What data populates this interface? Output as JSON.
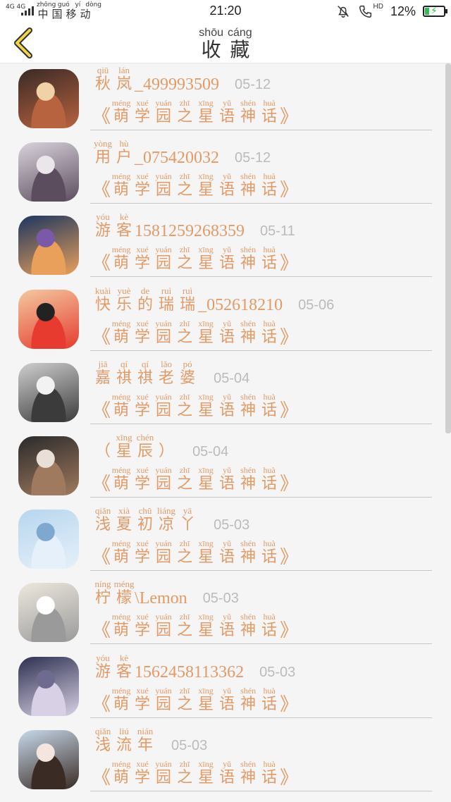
{
  "status_bar": {
    "network": "4G 4G",
    "carrier": [
      {
        "py": "zhōng",
        "hz": "中"
      },
      {
        "py": "guó",
        "hz": "国"
      },
      {
        "py": "yí",
        "hz": "移"
      },
      {
        "py": "dòng",
        "hz": "动"
      }
    ],
    "time": "21:20",
    "hd_label": "HD",
    "battery": "12%"
  },
  "header": {
    "back_icon": "chevron-left-icon",
    "title": [
      {
        "py": "shōu",
        "hz": "收"
      },
      {
        "py": "cáng",
        "hz": "藏"
      }
    ]
  },
  "subtitle": {
    "open": "《",
    "close": "》",
    "chars": [
      {
        "py": "méng",
        "hz": "萌"
      },
      {
        "py": "xué",
        "hz": "学"
      },
      {
        "py": "yuán",
        "hz": "园"
      },
      {
        "py": "zhī",
        "hz": "之"
      },
      {
        "py": "xīng",
        "hz": "星"
      },
      {
        "py": "yǔ",
        "hz": "语"
      },
      {
        "py": "shén",
        "hz": "神"
      },
      {
        "py": "huà",
        "hz": "话"
      }
    ]
  },
  "items": [
    {
      "name": [
        {
          "py": "qiū",
          "hz": "秋"
        },
        {
          "py": "lán",
          "hz": "岚"
        }
      ],
      "suffix": "_499993509",
      "date": "05-12",
      "avatar": {
        "c1": "#3a2a26",
        "c2": "#b8633f",
        "c3": "#f1d1a8"
      }
    },
    {
      "name": [
        {
          "py": "yòng",
          "hz": "用"
        },
        {
          "py": "hù",
          "hz": "户"
        }
      ],
      "suffix": "_075420032",
      "date": "05-12",
      "avatar": {
        "c1": "#d9d3dc",
        "c2": "#5c4d5e",
        "c3": "#eae6ea"
      }
    },
    {
      "name": [
        {
          "py": "yóu",
          "hz": "游"
        },
        {
          "py": "kè",
          "hz": "客"
        }
      ],
      "suffix": "1581259268359",
      "date": "05-11",
      "avatar": {
        "c1": "#1c3560",
        "c2": "#e9a05a",
        "c3": "#7a5aa8"
      }
    },
    {
      "name": [
        {
          "py": "kuài",
          "hz": "快"
        },
        {
          "py": "yuè",
          "hz": "乐"
        },
        {
          "py": "de",
          "hz": "的"
        },
        {
          "py": "ruì",
          "hz": "瑞"
        },
        {
          "py": "ruì",
          "hz": "瑞"
        }
      ],
      "suffix": "_052618210",
      "date": "05-06",
      "avatar": {
        "c1": "#f3c9a0",
        "c2": "#e63b2e",
        "c3": "#222222"
      }
    },
    {
      "name": [
        {
          "py": "jiā",
          "hz": "嘉"
        },
        {
          "py": "qí",
          "hz": "祺"
        },
        {
          "py": "qí",
          "hz": "祺"
        },
        {
          "py": "lǎo",
          "hz": "老"
        },
        {
          "py": "pó",
          "hz": "婆"
        }
      ],
      "suffix": "",
      "date": "05-04",
      "avatar": {
        "c1": "#cfcfcf",
        "c2": "#3b3b3b",
        "c3": "#f2f2f2"
      }
    },
    {
      "name": [
        {
          "py": "",
          "hz": "（"
        },
        {
          "py": "xīng",
          "hz": "星"
        },
        {
          "py": "chén",
          "hz": "辰"
        },
        {
          "py": "",
          "hz": "）"
        }
      ],
      "suffix": "",
      "date": "05-04",
      "avatar": {
        "c1": "#2a2a2a",
        "c2": "#a07a5e",
        "c3": "#e8e0d8"
      }
    },
    {
      "name": [
        {
          "py": "qiǎn",
          "hz": "浅"
        },
        {
          "py": "xià",
          "hz": "夏"
        },
        {
          "py": "chū",
          "hz": "初"
        },
        {
          "py": "liáng",
          "hz": "凉"
        },
        {
          "py": "yā",
          "hz": "丫"
        }
      ],
      "suffix": "",
      "date": "05-03",
      "avatar": {
        "c1": "#b7d6ee",
        "c2": "#e6f0fa",
        "c3": "#7fa8d0"
      }
    },
    {
      "name": [
        {
          "py": "níng",
          "hz": "柠"
        },
        {
          "py": "méng",
          "hz": "檬"
        }
      ],
      "suffix": "\\Lemon",
      "date": "05-03",
      "avatar": {
        "c1": "#ede8de",
        "c2": "#9a9a9a",
        "c3": "#ffffff"
      }
    },
    {
      "name": [
        {
          "py": "yóu",
          "hz": "游"
        },
        {
          "py": "kè",
          "hz": "客"
        }
      ],
      "suffix": "1562458113362",
      "date": "05-03",
      "avatar": {
        "c1": "#2d3050",
        "c2": "#d8d0e4",
        "c3": "#6f6a8f"
      }
    },
    {
      "name": [
        {
          "py": "qiǎn",
          "hz": "浅"
        },
        {
          "py": "liú",
          "hz": "流"
        },
        {
          "py": "nián",
          "hz": "年"
        }
      ],
      "suffix": "",
      "date": "05-03",
      "avatar": {
        "c1": "#c7d9ea",
        "c2": "#3a2b25",
        "c3": "#f4e6de"
      }
    }
  ]
}
